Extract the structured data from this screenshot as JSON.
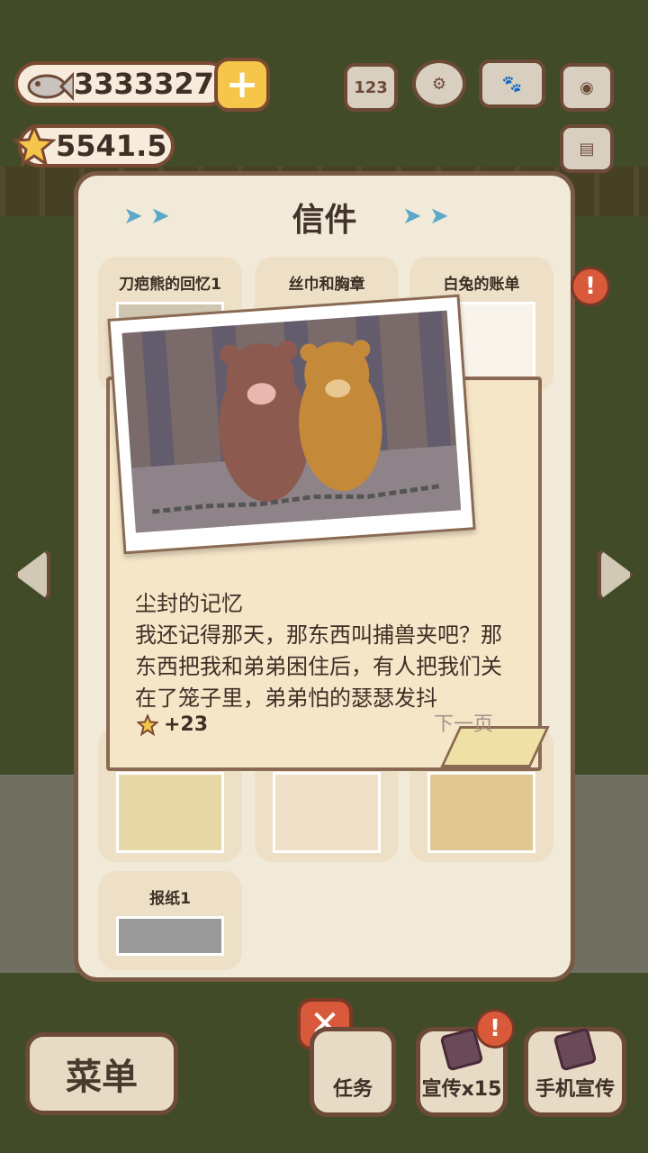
{
  "currency": {
    "fish_amount": "3333327",
    "star_amount": "5541.5"
  },
  "top_icons": {
    "ranking": "123"
  },
  "panel": {
    "title": "信件",
    "cards": [
      {
        "label": "刀疤熊的回忆1"
      },
      {
        "label": "丝巾和胸章"
      },
      {
        "label": "白兔的账单"
      },
      {
        "label": "报纸1"
      }
    ]
  },
  "letter": {
    "title": "尘封的记忆",
    "body": "我还记得那天，那东西叫捕兽夹吧？那东西把我和弟弟困住后，有人把我们关在了笼子里，弟弟怕的瑟瑟发抖",
    "reward": "+23",
    "next_page": "下一页"
  },
  "bottom": {
    "menu": "菜单",
    "tasks": "任务",
    "promote": "宣传x15",
    "phone_promote": "手机宣传",
    "alert": "!"
  },
  "colors": {
    "accent": "#f6c64a",
    "close": "#d9593b",
    "panel": "#f2ead9",
    "border": "#7a5a45"
  }
}
